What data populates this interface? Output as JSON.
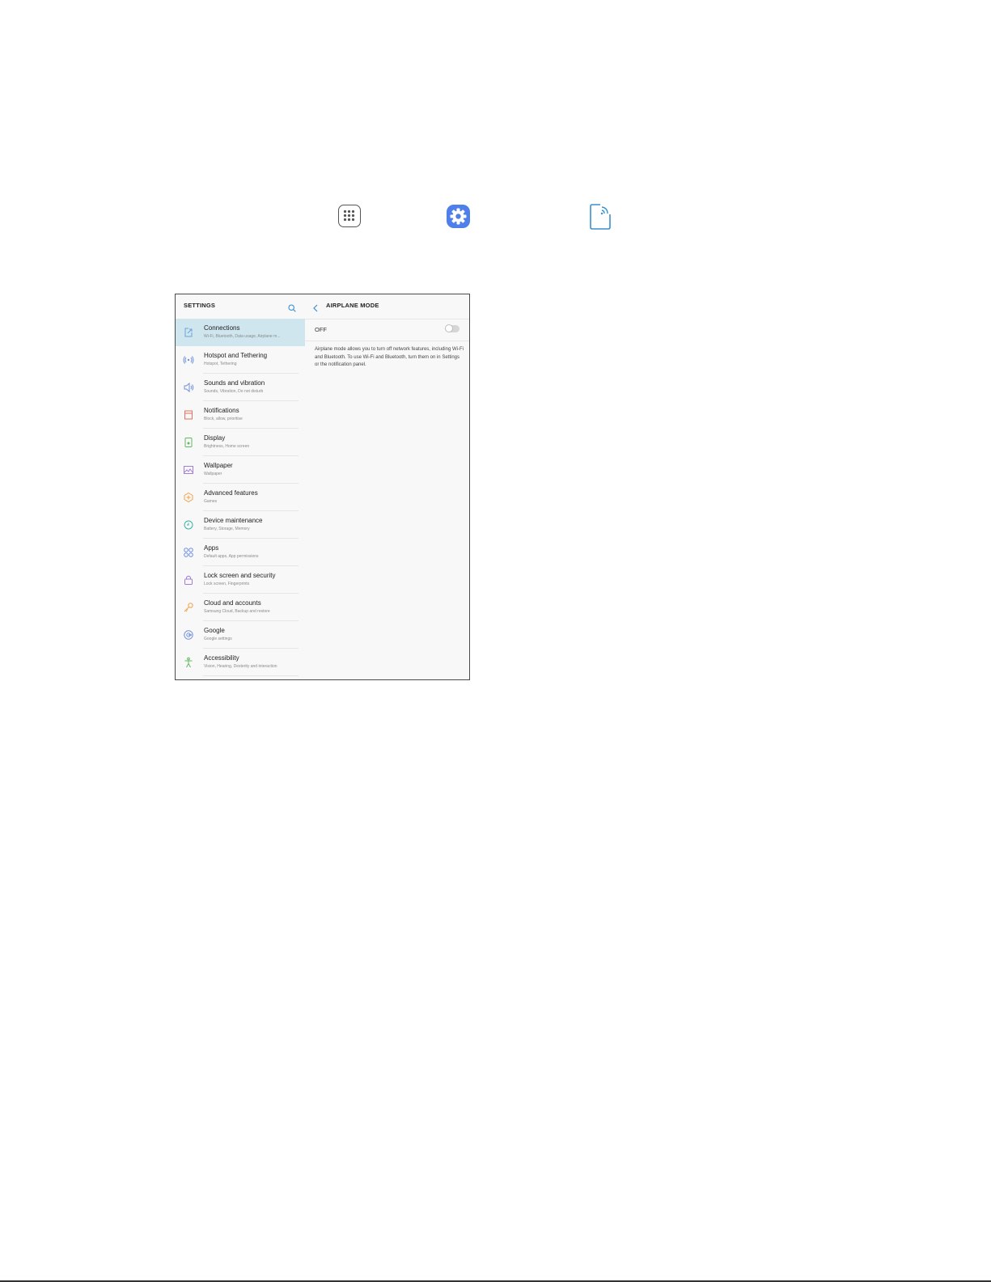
{
  "top_icons": [
    "apps-icon",
    "settings-icon",
    "connections-icon"
  ],
  "left_panel": {
    "title": "SETTINGS",
    "items": [
      {
        "title": "Connections",
        "subtitle": "Wi-Fi, Bluetooth, Data usage, Airplane m...",
        "icon": "connections-icon",
        "color": "#6aa3d9",
        "selected": true
      },
      {
        "title": "Hotspot and Tethering",
        "subtitle": "Hotspot, Tethering",
        "icon": "hotspot-icon",
        "color": "#6f8fdc"
      },
      {
        "title": "Sounds and vibration",
        "subtitle": "Sounds, Vibration, Do not disturb",
        "icon": "sound-icon",
        "color": "#6f8fdc"
      },
      {
        "title": "Notifications",
        "subtitle": "Block, allow, prioritise",
        "icon": "notifications-icon",
        "color": "#e0725f"
      },
      {
        "title": "Display",
        "subtitle": "Brightness, Home screen",
        "icon": "display-icon",
        "color": "#5fb85f"
      },
      {
        "title": "Wallpaper",
        "subtitle": "Wallpaper",
        "icon": "wallpaper-icon",
        "color": "#a27ed6"
      },
      {
        "title": "Advanced features",
        "subtitle": "Games",
        "icon": "advanced-features-icon",
        "color": "#f0a34a"
      },
      {
        "title": "Device maintenance",
        "subtitle": "Battery, Storage, Memory",
        "icon": "device-maintenance-icon",
        "color": "#3ab3a3"
      },
      {
        "title": "Apps",
        "subtitle": "Default apps, App permissions",
        "icon": "apps-grid-icon",
        "color": "#6f8fdc"
      },
      {
        "title": "Lock screen and security",
        "subtitle": "Lock screen, Fingerprints",
        "icon": "lock-icon",
        "color": "#a27ed6"
      },
      {
        "title": "Cloud and accounts",
        "subtitle": "Samsung Cloud, Backup and restore",
        "icon": "key-icon",
        "color": "#f0a34a"
      },
      {
        "title": "Google",
        "subtitle": "Google settings",
        "icon": "google-icon",
        "color": "#6f8fdc"
      },
      {
        "title": "Accessibility",
        "subtitle": "Vision, Hearing, Dexterity and interaction",
        "icon": "accessibility-icon",
        "color": "#5fb85f"
      }
    ]
  },
  "right_panel": {
    "title": "AIRPLANE MODE",
    "toggle_label": "OFF",
    "toggle_state": "off",
    "description": "Airplane mode allows you to turn off network features, including Wi-Fi and Bluetooth. To use Wi-Fi and Bluetooth, turn them on in Settings or the notification panel."
  }
}
